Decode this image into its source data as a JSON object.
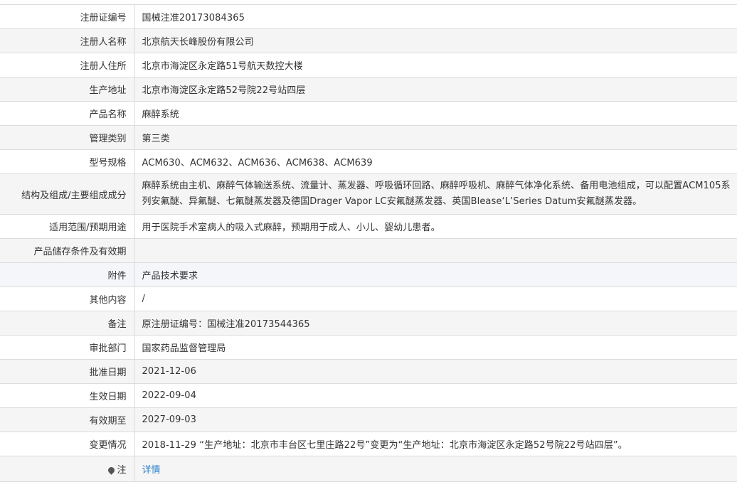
{
  "rows": [
    {
      "label": "注册证编号",
      "value": "国械注准20173084365"
    },
    {
      "label": "注册人名称",
      "value": "北京航天长峰股份有限公司"
    },
    {
      "label": "注册人住所",
      "value": "北京市海淀区永定路51号航天数控大楼"
    },
    {
      "label": "生产地址",
      "value": "北京市海淀区永定路52号院22号站四层"
    },
    {
      "label": "产品名称",
      "value": "麻醉系统"
    },
    {
      "label": "管理类别",
      "value": "第三类"
    },
    {
      "label": "型号规格",
      "value": "ACM630、ACM632、ACM636、ACM638、ACM639"
    },
    {
      "label": "结构及组成/主要组成成分",
      "value": "麻醉系统由主机、麻醉气体输送系统、流量计、蒸发器、呼吸循环回路、麻醉呼吸机、麻醉气体净化系统、备用电池组成，可以配置ACM105系列安氟醚、异氟醚、七氟醚蒸发器及德国Drager Vapor LC安氟醚蒸发器、英国Blease‘L’Series Datum安氟醚蒸发器。"
    },
    {
      "label": "适用范围/预期用途",
      "value": "用于医院手术室病人的吸入式麻醉，预期用于成人、小儿、婴幼儿患者。"
    },
    {
      "label": "产品储存条件及有效期",
      "value": ""
    },
    {
      "label": "附件",
      "value": "产品技术要求"
    },
    {
      "label": "其他内容",
      "value": "/"
    },
    {
      "label": "备注",
      "value": "原注册证编号：国械注准20173544365"
    },
    {
      "label": "审批部门",
      "value": "国家药品监督管理局"
    },
    {
      "label": "批准日期",
      "value": "2021-12-06"
    },
    {
      "label": "生效日期",
      "value": "2022-09-04"
    },
    {
      "label": "有效期至",
      "value": "2027-09-03"
    },
    {
      "label": "变更情况",
      "value": "2018-11-29 “生产地址：北京市丰台区七里庄路22号”变更为“生产地址：北京市海淀区永定路52号院22号站四层”。"
    },
    {
      "label": "注",
      "value": "详情"
    }
  ],
  "icons": {
    "note": "pin-icon"
  },
  "colors": {
    "link": "#2a7ecb",
    "border": "#dcdcdc",
    "stripe": "#f5f5f5"
  }
}
